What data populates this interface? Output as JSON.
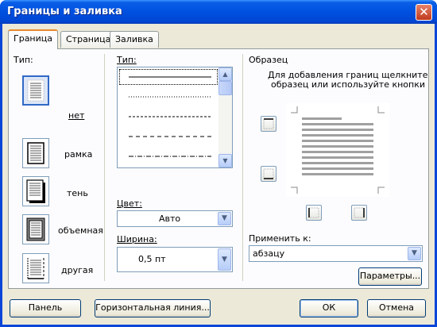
{
  "window": {
    "title": "Границы и заливка",
    "close_glyph": "✕"
  },
  "tabs": [
    {
      "label": "Граница",
      "active": true
    },
    {
      "label": "Страница",
      "active": false
    },
    {
      "label": "Заливка",
      "active": false
    }
  ],
  "setting": {
    "type_label": "Тип:",
    "presets": [
      {
        "label": "нет",
        "icon": "border-none-icon",
        "selected": true
      },
      {
        "label": "рамка",
        "icon": "border-box-icon",
        "selected": false
      },
      {
        "label": "тень",
        "icon": "border-shadow-icon",
        "selected": false
      },
      {
        "label": "объемная",
        "icon": "border-3d-icon",
        "selected": false
      },
      {
        "label": "другая",
        "icon": "border-custom-icon",
        "selected": false
      }
    ]
  },
  "style": {
    "type_label": "Тип:",
    "line_styles": [
      "solid",
      "dotted",
      "dashed",
      "long-dash",
      "dash-dot"
    ],
    "color_label": "Цвет:",
    "color_value": "Авто",
    "width_label": "Ширина:",
    "width_value": "0,5 пт"
  },
  "preview": {
    "heading": "Образец",
    "hint_line1": "Для добавления границ щелкните",
    "hint_line2": "образец или используйте кнопки",
    "apply_label": "Применить к:",
    "apply_value": "абзацу",
    "options_button": "Параметры..."
  },
  "footer": {
    "panel_button": "Панель",
    "hline_button": "Горизонтальная линия...",
    "ok_button": "ОК",
    "cancel_button": "Отмена"
  },
  "colors": {
    "title_bar": "#0050e0",
    "dialog_face": "#ece9d8",
    "tab_highlight": "#e68b2c",
    "selection": "#3169c6"
  }
}
